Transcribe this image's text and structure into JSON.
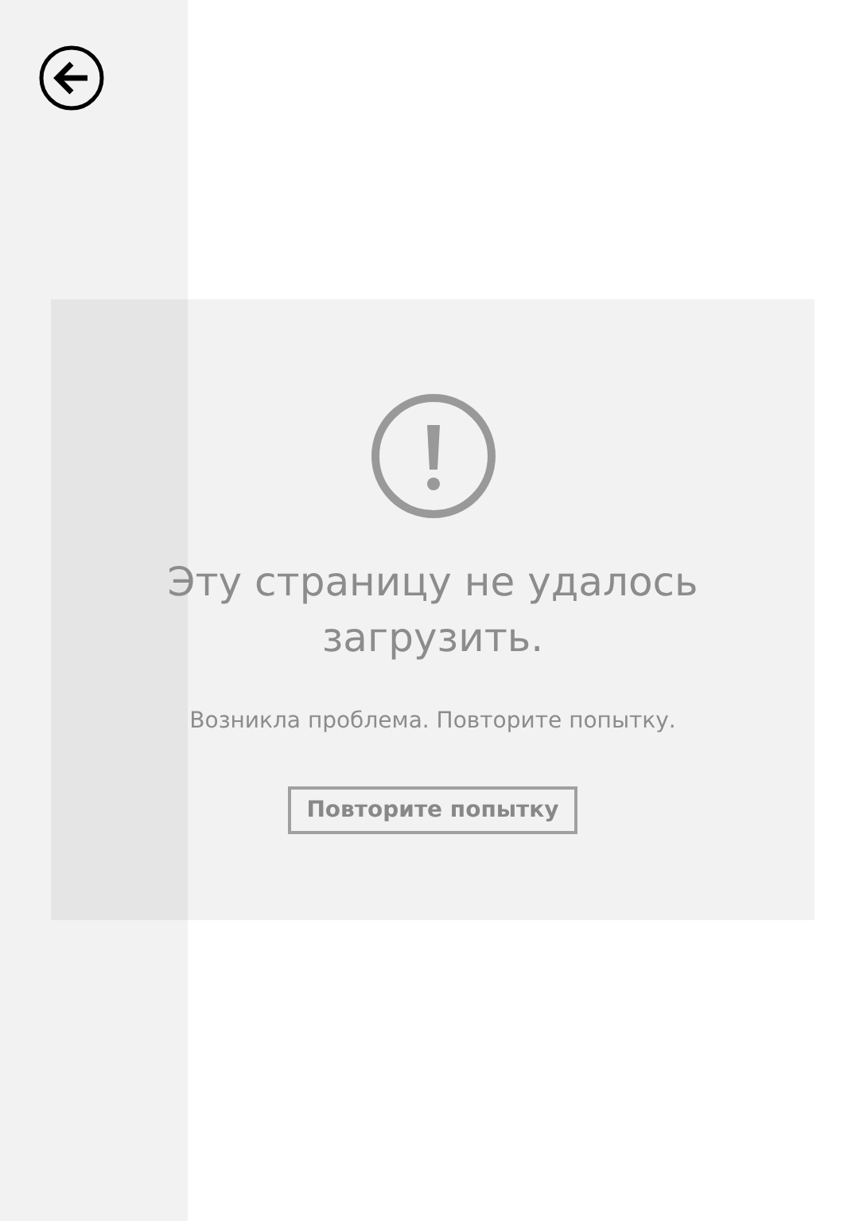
{
  "error": {
    "title": "Эту страницу не удалось загрузить.",
    "message": "Возникла проблема. Повторите попытку.",
    "retry_button": "Повторите попытку"
  }
}
